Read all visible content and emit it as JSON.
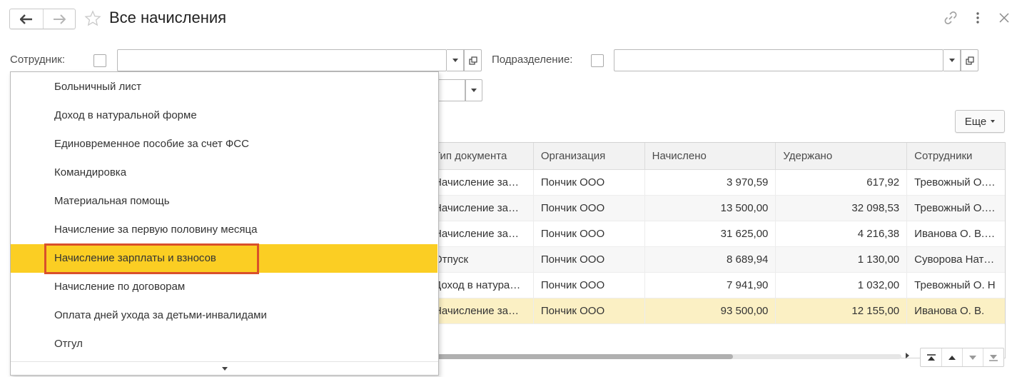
{
  "window": {
    "title": "Все начисления",
    "icons": [
      "arrow-left-icon",
      "arrow-right-icon",
      "star-icon",
      "link-icon",
      "more-vertical-icon",
      "close-icon"
    ]
  },
  "filters": {
    "employee_label": "Сотрудник:",
    "employee_value": "",
    "department_label": "Подразделение:",
    "department_value": ""
  },
  "toolbar": {
    "more_label": "Еще"
  },
  "table": {
    "columns": [
      "Тип документа",
      "Организация",
      "Начислено",
      "Удержано",
      "Сотрудники"
    ],
    "rows": [
      {
        "type": "Начисление за…",
        "org": "Пончик ООО",
        "accrued": "3 970,59",
        "withheld": "617,92",
        "employees": "Тревожный О. …",
        "selected": false
      },
      {
        "type": "Начисление за…",
        "org": "Пончик ООО",
        "accrued": "13 500,00",
        "withheld": "32 098,53",
        "employees": "Тревожный О. …",
        "selected": false
      },
      {
        "type": "Начисление за…",
        "org": "Пончик ООО",
        "accrued": "31 625,00",
        "withheld": "4 216,38",
        "employees": "Иванова О. В., …",
        "selected": false
      },
      {
        "type": "Отпуск",
        "org": "Пончик ООО",
        "accrued": "8 689,94",
        "withheld": "1 130,00",
        "employees": "Суворова Ната…",
        "selected": false
      },
      {
        "type": "Доход в натура…",
        "org": "Пончик ООО",
        "accrued": "7 941,90",
        "withheld": "1 032,00",
        "employees": "Тревожный О. Н",
        "selected": false
      },
      {
        "type": "Начисление за…",
        "org": "Пончик ООО",
        "accrued": "93 500,00",
        "withheld": "12 155,00",
        "employees": "Иванова О. В.",
        "selected": true
      }
    ]
  },
  "dropdown": {
    "items": [
      "Больничный лист",
      "Доход в натуральной форме",
      "Единовременное пособие за счет ФСС",
      "Командировка",
      "Материальная помощь",
      "Начисление за первую половину месяца",
      "Начисление зарплаты и взносов",
      "Начисление по договорам",
      "Оплата дней ухода за детьми-инвалидами",
      "Отгул"
    ],
    "highlighted_index": 6
  },
  "colors": {
    "highlight": "#fbce23",
    "highlight_outline": "#d9502b",
    "selected_row": "#fbf0c4"
  }
}
